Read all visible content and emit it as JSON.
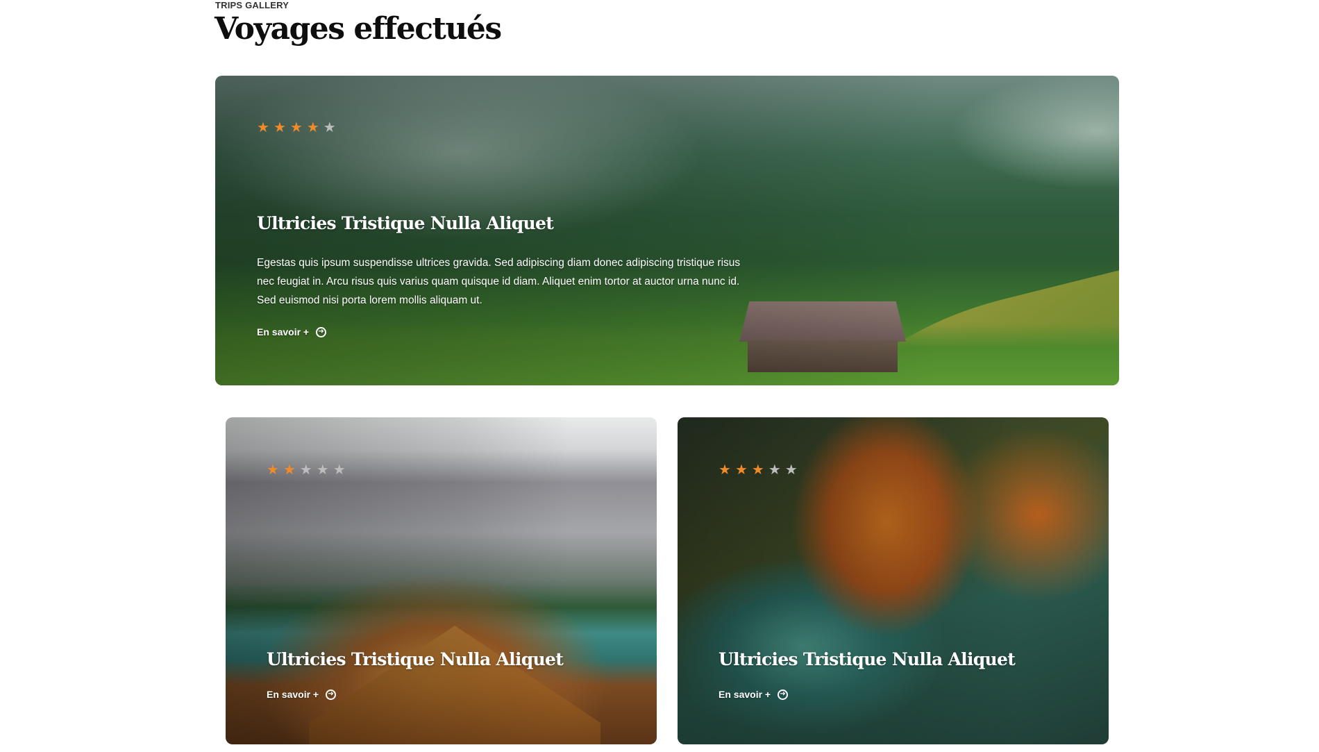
{
  "header": {
    "eyebrow": "TRIPS GALLERY",
    "title": "Voyages effectués"
  },
  "cards": [
    {
      "rating": 4,
      "max_rating": 5,
      "title": "Ultricies Tristique Nulla Aliquet",
      "text": "Egestas quis ipsum suspendisse ultrices gravida. Sed adipiscing diam donec adipiscing tristique risus nec feugiat in. Arcu risus quis varius quam quisque id diam. Aliquet enim tortor at auctor urna nunc id. Sed euismod nisi porta lorem mollis aliquam ut.",
      "cta_label": "En savoir +"
    },
    {
      "rating": 2,
      "max_rating": 5,
      "title": "Ultricies Tristique Nulla Aliquet",
      "cta_label": "En savoir +"
    },
    {
      "rating": 3,
      "max_rating": 5,
      "title": "Ultricies Tristique Nulla Aliquet",
      "cta_label": "En savoir +"
    }
  ],
  "icons": {
    "star": "star-icon",
    "cta": "arrow-circle-right-icon"
  },
  "colors": {
    "star_on": "#f08a2a",
    "star_off": "#bdbdbd",
    "title": "#0e0e0e"
  }
}
